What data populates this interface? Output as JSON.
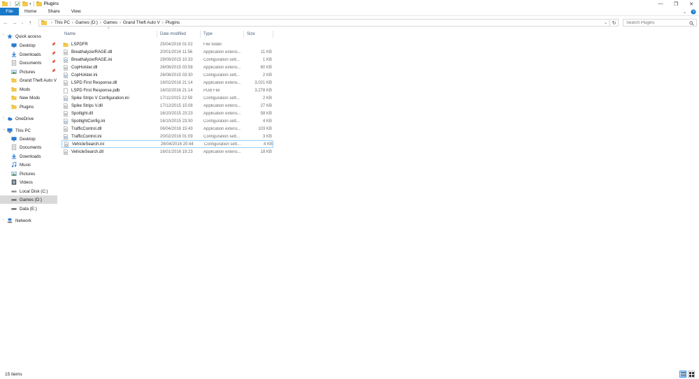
{
  "window": {
    "title": "Plugins",
    "controls": {
      "minimize": "—",
      "restore": "❐",
      "close": "✕"
    }
  },
  "ribbon": {
    "tabs": [
      {
        "label": "File",
        "active": true
      },
      {
        "label": "Home"
      },
      {
        "label": "Share"
      },
      {
        "label": "View"
      }
    ]
  },
  "address": {
    "crumbs": [
      "This PC",
      "Games (D:)",
      "Games",
      "Grand Theft Auto V",
      "Plugins"
    ],
    "search_placeholder": "Search Plugins"
  },
  "nav": {
    "quick_access": "Quick access",
    "quick_items": [
      {
        "label": "Desktop",
        "icon": "desktop-icon",
        "pinned": true
      },
      {
        "label": "Downloads",
        "icon": "downloads-icon",
        "pinned": true
      },
      {
        "label": "Documents",
        "icon": "documents-icon",
        "pinned": true
      },
      {
        "label": "Pictures",
        "icon": "pictures-icon",
        "pinned": true
      },
      {
        "label": "Grand Theft Auto V",
        "icon": "folder-icon"
      },
      {
        "label": "Mods",
        "icon": "folder-icon"
      },
      {
        "label": "New Mods",
        "icon": "folder-icon"
      },
      {
        "label": "Plugins",
        "icon": "folder-icon"
      }
    ],
    "onedrive": "OneDrive",
    "this_pc": "This PC",
    "pc_items": [
      {
        "label": "Desktop",
        "icon": "desktop-icon"
      },
      {
        "label": "Documents",
        "icon": "documents-icon"
      },
      {
        "label": "Downloads",
        "icon": "downloads-icon"
      },
      {
        "label": "Music",
        "icon": "music-icon"
      },
      {
        "label": "Pictures",
        "icon": "pictures-icon"
      },
      {
        "label": "Videos",
        "icon": "videos-icon"
      },
      {
        "label": "Local Disk (C:)",
        "icon": "drive-icon"
      },
      {
        "label": "Games (D:)",
        "icon": "drive-icon",
        "selected": true
      },
      {
        "label": "Data (E:)",
        "icon": "drive-icon"
      }
    ],
    "network": "Network"
  },
  "columns": {
    "name": "Name",
    "date": "Date modified",
    "type": "Type",
    "size": "Size"
  },
  "files": [
    {
      "name": "LSPDFR",
      "date": "25/04/2016 01:02",
      "type": "File folder",
      "size": "",
      "icon": "folder"
    },
    {
      "name": "BreathalyzerRAGE.dll",
      "date": "20/01/2016 11:56",
      "type": "Application extens...",
      "size": "11 KB",
      "icon": "dll"
    },
    {
      "name": "BreathalyzerRAGE.ini",
      "date": "29/09/2015 10:33",
      "type": "Configuration sett...",
      "size": "1 KB",
      "icon": "ini"
    },
    {
      "name": "CopHolster.dll",
      "date": "26/08/2015 03:58",
      "type": "Application extens...",
      "size": "60 KB",
      "icon": "dll"
    },
    {
      "name": "CopHolster.ini",
      "date": "26/08/2015 03:30",
      "type": "Configuration sett...",
      "size": "2 KB",
      "icon": "ini"
    },
    {
      "name": "LSPD First Response.dll",
      "date": "16/02/2016 21:14",
      "type": "Application extens...",
      "size": "3,021 KB",
      "icon": "dll"
    },
    {
      "name": "LSPD First Response.pdb",
      "date": "16/02/2016 21:14",
      "type": "PDB File",
      "size": "3,278 KB",
      "icon": "file"
    },
    {
      "name": "Spike Strips V Configuration.ini",
      "date": "17/11/2015 22:59",
      "type": "Configuration sett...",
      "size": "2 KB",
      "icon": "ini"
    },
    {
      "name": "Spike Strips V.dll",
      "date": "17/12/2015 15:08",
      "type": "Application extens...",
      "size": "27 KB",
      "icon": "dll"
    },
    {
      "name": "Spotlight.dll",
      "date": "16/10/2015 23:23",
      "type": "Application extens...",
      "size": "58 KB",
      "icon": "dll"
    },
    {
      "name": "SpotlightConfig.ini",
      "date": "16/10/2015 23:30",
      "type": "Configuration sett...",
      "size": "4 KB",
      "icon": "ini"
    },
    {
      "name": "TrafficControl.dll",
      "date": "06/04/2016 15:43",
      "type": "Application extens...",
      "size": "103 KB",
      "icon": "dll"
    },
    {
      "name": "TrafficControl.ini",
      "date": "20/02/2016 01:09",
      "type": "Configuration sett...",
      "size": "3 KB",
      "icon": "ini"
    },
    {
      "name": "VehicleSearch.ini",
      "date": "26/04/2016 20:44",
      "type": "Configuration sett...",
      "size": "4 KB",
      "icon": "ini",
      "selected": true
    },
    {
      "name": "VehicleSearch.dll",
      "date": "16/01/2016 19:23",
      "type": "Application extens...",
      "size": "18 KB",
      "icon": "dll"
    }
  ],
  "status": {
    "item_count": "15 items"
  },
  "colors": {
    "accent": "#1979ca",
    "selection_border": "#99d1ff",
    "folder": "#f2c94c",
    "selected_nav": "#d9d9d9"
  }
}
